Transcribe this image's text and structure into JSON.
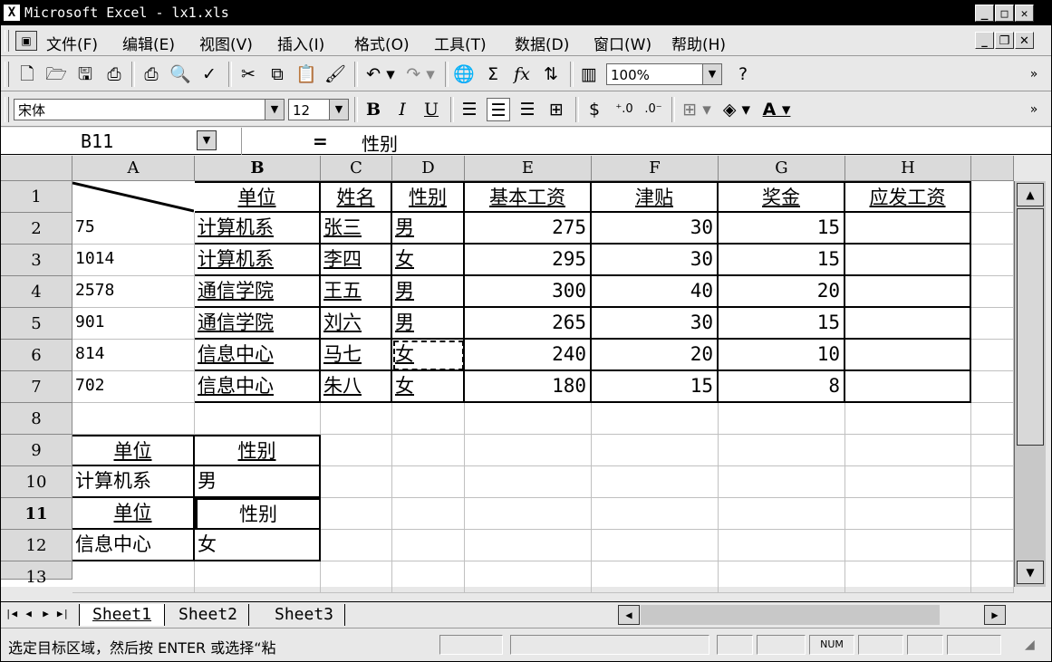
{
  "window": {
    "title": "Microsoft Excel - lx1.xls",
    "app_icon": "X"
  },
  "menu": [
    "文件(F)",
    "编辑(E)",
    "视图(V)",
    "插入(I)",
    "格式(O)",
    "工具(T)",
    "数据(D)",
    "窗口(W)",
    "帮助(H)"
  ],
  "toolbar": {
    "icons": [
      "new-icon",
      "open-icon",
      "save-icon",
      "permission-icon",
      "print-icon",
      "print-preview-icon",
      "spelling-icon",
      "cut-icon",
      "copy-icon",
      "paste-icon",
      "format-painter-icon",
      "undo-icon",
      "redo-icon",
      "hyperlink-icon",
      "autosum-icon",
      "function-icon",
      "sort-ascending-icon",
      "chart-wizard-icon"
    ],
    "autosum_glyph": "Σ",
    "function_glyph": "fx",
    "zoom": "100%"
  },
  "format_bar": {
    "font": "宋体",
    "size": "12",
    "bold": "B",
    "italic": "I",
    "underline": "U"
  },
  "formula_bar": {
    "name_box": "B11",
    "equals": "=",
    "content": "性别"
  },
  "columns": [
    "A",
    "B",
    "C",
    "D",
    "E",
    "F",
    "G",
    "H"
  ],
  "rows": [
    "1",
    "2",
    "3",
    "4",
    "5",
    "6",
    "7",
    "8",
    "9",
    "10",
    "11",
    "12",
    "13"
  ],
  "header_row": [
    "单位",
    "姓名",
    "性别",
    "基本工资",
    "津贴",
    "奖金",
    "应发工资"
  ],
  "data_rows": [
    {
      "a": "75",
      "unit": "计算机系",
      "name": "张三",
      "sex": "男",
      "base": "275",
      "allow": "30",
      "bonus": "15"
    },
    {
      "a": "1014",
      "unit": "计算机系",
      "name": "李四",
      "sex": "女",
      "base": "295",
      "allow": "30",
      "bonus": "15"
    },
    {
      "a": "2578",
      "unit": "通信学院",
      "name": "王五",
      "sex": "男",
      "base": "300",
      "allow": "40",
      "bonus": "20"
    },
    {
      "a": "901",
      "unit": "通信学院",
      "name": "刘六",
      "sex": "男",
      "base": "265",
      "allow": "30",
      "bonus": "15"
    },
    {
      "a": "814",
      "unit": "信息中心",
      "name": "马七",
      "sex": "女",
      "base": "240",
      "allow": "20",
      "bonus": "10"
    },
    {
      "a": "702",
      "unit": "信息中心",
      "name": "朱八",
      "sex": "女",
      "base": "180",
      "allow": "15",
      "bonus": "8"
    }
  ],
  "criteria1": {
    "h_unit": "单位",
    "h_sex": "性别",
    "v_unit": "计算机系",
    "v_sex": "男"
  },
  "criteria2": {
    "h_unit": "单位",
    "h_sex": "性别",
    "v_unit": "信息中心",
    "v_sex": "女"
  },
  "sheets": [
    "Sheet1",
    "Sheet2",
    "Sheet3"
  ],
  "status": {
    "message": "选定目标区域，然后按 ENTER 或选择“粘",
    "num": "NUM"
  }
}
